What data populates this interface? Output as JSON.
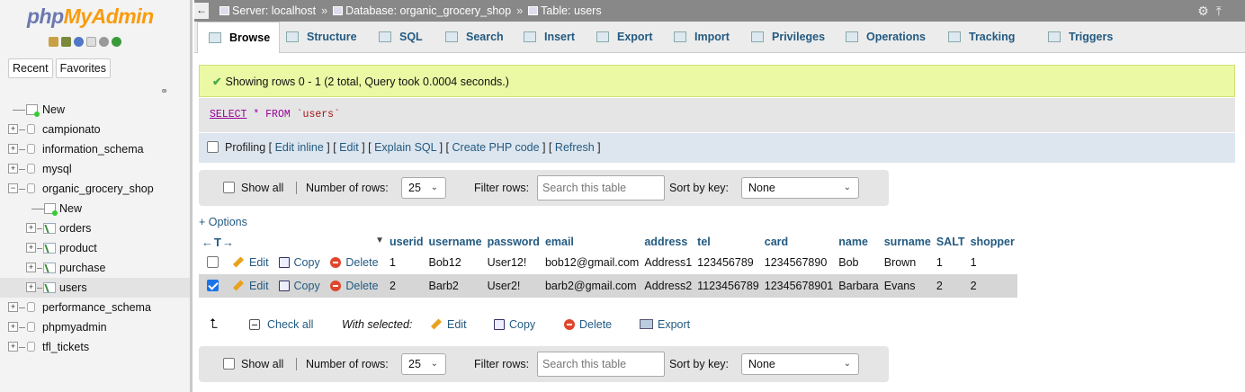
{
  "sidebar": {
    "logo_part1": "php",
    "logo_part2": "MyAdmin",
    "quick_icons": [
      "home-icon",
      "exit-icon",
      "help-icon",
      "docs-icon",
      "settings-icon",
      "reload-icon"
    ],
    "tabs": [
      "Recent",
      "Favorites"
    ],
    "tree": {
      "new": "New",
      "databases": [
        "campionato",
        "information_schema",
        "mysql",
        "organic_grocery_shop"
      ],
      "db_new": "New",
      "tables": [
        "orders",
        "product",
        "purchase",
        "users"
      ],
      "databases_after": [
        "performance_schema",
        "phpmyadmin",
        "tfl_tickets"
      ]
    }
  },
  "breadcrumb": {
    "server": "Server: localhost",
    "database": "Database: organic_grocery_shop",
    "table": "Table: users",
    "separator": "»"
  },
  "menu": {
    "tabs": [
      "Browse",
      "Structure",
      "SQL",
      "Search",
      "Insert",
      "Export",
      "Import",
      "Privileges",
      "Operations",
      "Tracking",
      "Triggers"
    ],
    "active": "Browse"
  },
  "success_message": "Showing rows 0 - 1 (2 total, Query took 0.0004 seconds.)",
  "sql": {
    "select": "SELECT",
    "star": "*",
    "from": "FROM",
    "table": "`users`"
  },
  "profiling": {
    "label": "Profiling",
    "links": [
      "Edit inline",
      "Edit",
      "Explain SQL",
      "Create PHP code",
      "Refresh"
    ]
  },
  "navbar": {
    "show_all": "Show all",
    "number_of_rows_label": "Number of rows:",
    "rows_value": "25",
    "filter_label": "Filter rows:",
    "filter_placeholder": "Search this table",
    "sort_label": "Sort by key:",
    "sort_value": "None"
  },
  "options_link": "+ Options",
  "col_arrows": "←T→",
  "table": {
    "columns": [
      "userid",
      "username",
      "password",
      "email",
      "address",
      "tel",
      "card",
      "name",
      "surname",
      "SALT",
      "shopper"
    ],
    "sorted_column": "userid",
    "row_actions": [
      "Edit",
      "Copy",
      "Delete"
    ],
    "rows": [
      {
        "checked": false,
        "cells": [
          "1",
          "Bob12",
          "User12!",
          "bob12@gmail.com",
          "Address1",
          "123456789",
          "1234567890",
          "Bob",
          "Brown",
          "1",
          "1"
        ]
      },
      {
        "checked": true,
        "cells": [
          "2",
          "Barb2",
          "User2!",
          "barb2@gmail.com",
          "Address2",
          "1123456789",
          "12345678901",
          "Barbara",
          "Evans",
          "2",
          "2"
        ]
      }
    ]
  },
  "bulk": {
    "check_all": "Check all",
    "with_selected": "With selected:",
    "actions": [
      "Edit",
      "Copy",
      "Delete",
      "Export"
    ]
  },
  "colors": {
    "link": "#235a81",
    "success_bg": "#ebf8a4",
    "delete_red": "#e0462c"
  }
}
